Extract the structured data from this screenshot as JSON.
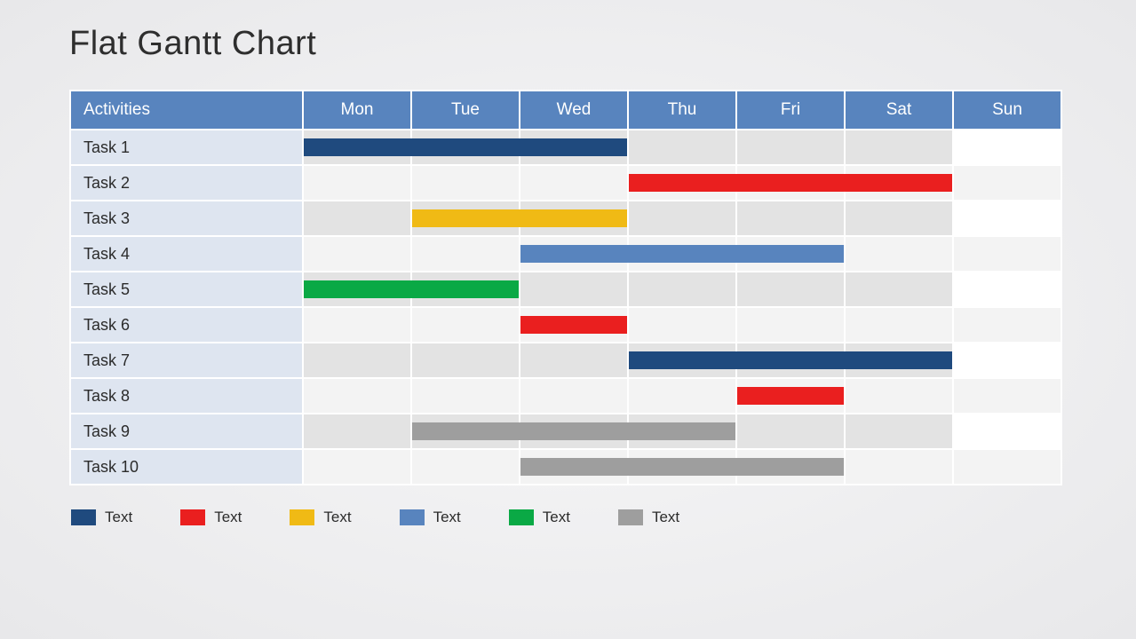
{
  "title": "Flat Gantt Chart",
  "header": {
    "activities": "Activities",
    "days": [
      "Mon",
      "Tue",
      "Wed",
      "Thu",
      "Fri",
      "Sat",
      "Sun"
    ]
  },
  "colors": {
    "darkblue": "#1f4a7e",
    "red": "#ea1f1f",
    "yellow": "#f0ba15",
    "blue": "#5884be",
    "green": "#0aa945",
    "gray": "#9e9e9e"
  },
  "rows": [
    {
      "label": "Task 1"
    },
    {
      "label": "Task 2"
    },
    {
      "label": "Task 3"
    },
    {
      "label": "Task 4"
    },
    {
      "label": "Task 5"
    },
    {
      "label": "Task 6"
    },
    {
      "label": "Task 7"
    },
    {
      "label": "Task 8"
    },
    {
      "label": "Task 9"
    },
    {
      "label": "Task 10"
    }
  ],
  "legend": [
    {
      "color": "darkblue",
      "label": "Text"
    },
    {
      "color": "red",
      "label": "Text"
    },
    {
      "color": "yellow",
      "label": "Text"
    },
    {
      "color": "blue",
      "label": "Text"
    },
    {
      "color": "green",
      "label": "Text"
    },
    {
      "color": "gray",
      "label": "Text"
    }
  ],
  "chart_data": {
    "type": "bar",
    "title": "Flat Gantt Chart",
    "categories": [
      "Mon",
      "Tue",
      "Wed",
      "Thu",
      "Fri",
      "Sat",
      "Sun"
    ],
    "series": [
      {
        "name": "Task 1",
        "color": "darkblue",
        "start": 0.0,
        "end": 3.0
      },
      {
        "name": "Task 2",
        "color": "red",
        "start": 3.0,
        "end": 6.0
      },
      {
        "name": "Task 3",
        "color": "yellow",
        "start": 1.0,
        "end": 3.0
      },
      {
        "name": "Task 4",
        "color": "blue",
        "start": 2.0,
        "end": 5.0
      },
      {
        "name": "Task 5",
        "color": "green",
        "start": -0.2,
        "end": 2.0
      },
      {
        "name": "Task 6",
        "color": "red",
        "start": 2.0,
        "end": 3.0
      },
      {
        "name": "Task 7",
        "color": "darkblue",
        "start": 3.0,
        "end": 6.0
      },
      {
        "name": "Task 8",
        "color": "red",
        "start": 4.0,
        "end": 5.0
      },
      {
        "name": "Task 9",
        "color": "gray",
        "start": 1.0,
        "end": 4.0
      },
      {
        "name": "Task 10",
        "color": "gray",
        "start": 2.0,
        "end": 5.0
      }
    ],
    "xlabel": "",
    "ylabel": "",
    "xlim": [
      0,
      7
    ]
  }
}
